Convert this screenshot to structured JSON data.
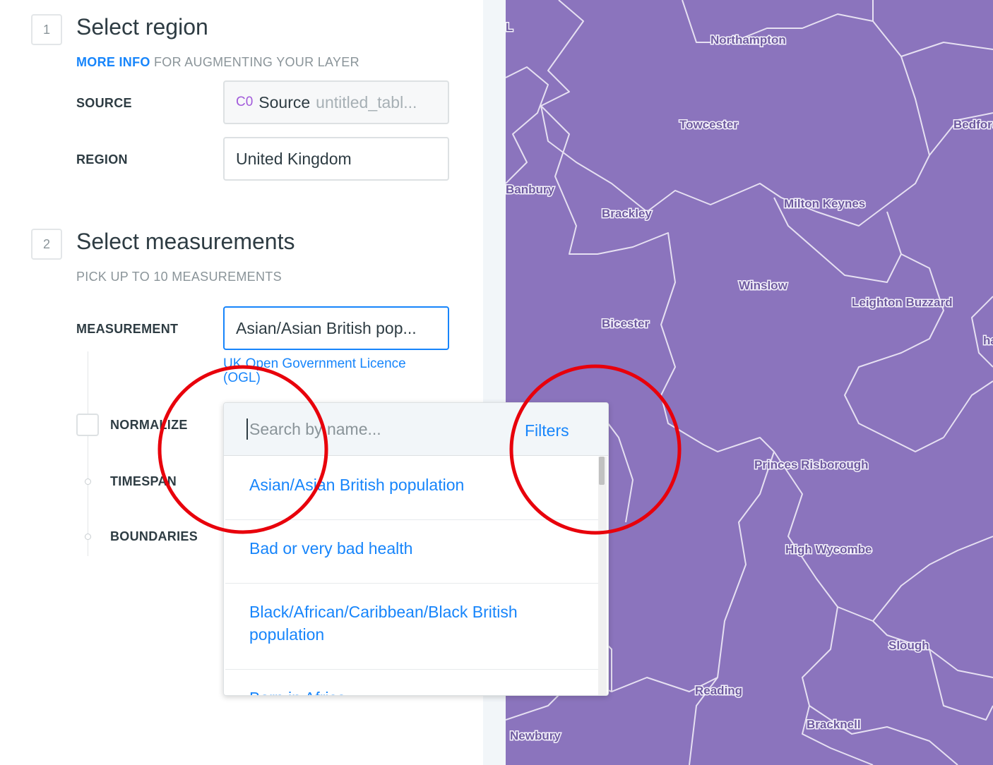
{
  "step1": {
    "number": "1",
    "title": "Select region",
    "more_info": "MORE INFO",
    "subtitle": "FOR AUGMENTING YOUR LAYER",
    "source_label": "SOURCE",
    "source_badge": "C0",
    "source_text": "Source",
    "source_table": "untitled_tabl...",
    "region_label": "REGION",
    "region_value": "United Kingdom"
  },
  "step2": {
    "number": "2",
    "title": "Select measurements",
    "subtitle": "PICK UP TO 10 MEASUREMENTS",
    "measurement_label": "MEASUREMENT",
    "measurement_value": "Asian/Asian British pop...",
    "licence_link": "UK Open Government Licence (OGL)",
    "normalize_label": "NORMALIZE",
    "timespan_label": "TIMESPAN",
    "boundaries_label": "BOUNDARIES"
  },
  "dropdown": {
    "search_placeholder": "Search by name...",
    "filters_label": "Filters",
    "items": [
      "Asian/Asian British population",
      "Bad or very bad health",
      "Black/African/Caribbean/Black British population",
      "Born in Africa"
    ]
  },
  "map": {
    "fill_color": "#8b74bd",
    "border_color": "#e6e0f2",
    "cities": [
      "Northampton",
      "Towcester",
      "Bedford",
      "Banbury",
      "Brackley",
      "Milton Keynes",
      "Winslow",
      "Leighton Buzzard",
      "Bicester",
      "Princes Risborough",
      "High Wycombe",
      "Slough",
      "Reading",
      "Bracknell",
      "Newbury",
      "ham",
      "L"
    ]
  },
  "annotation_color": "#e8000b",
  "accent_color": "#1785fb"
}
